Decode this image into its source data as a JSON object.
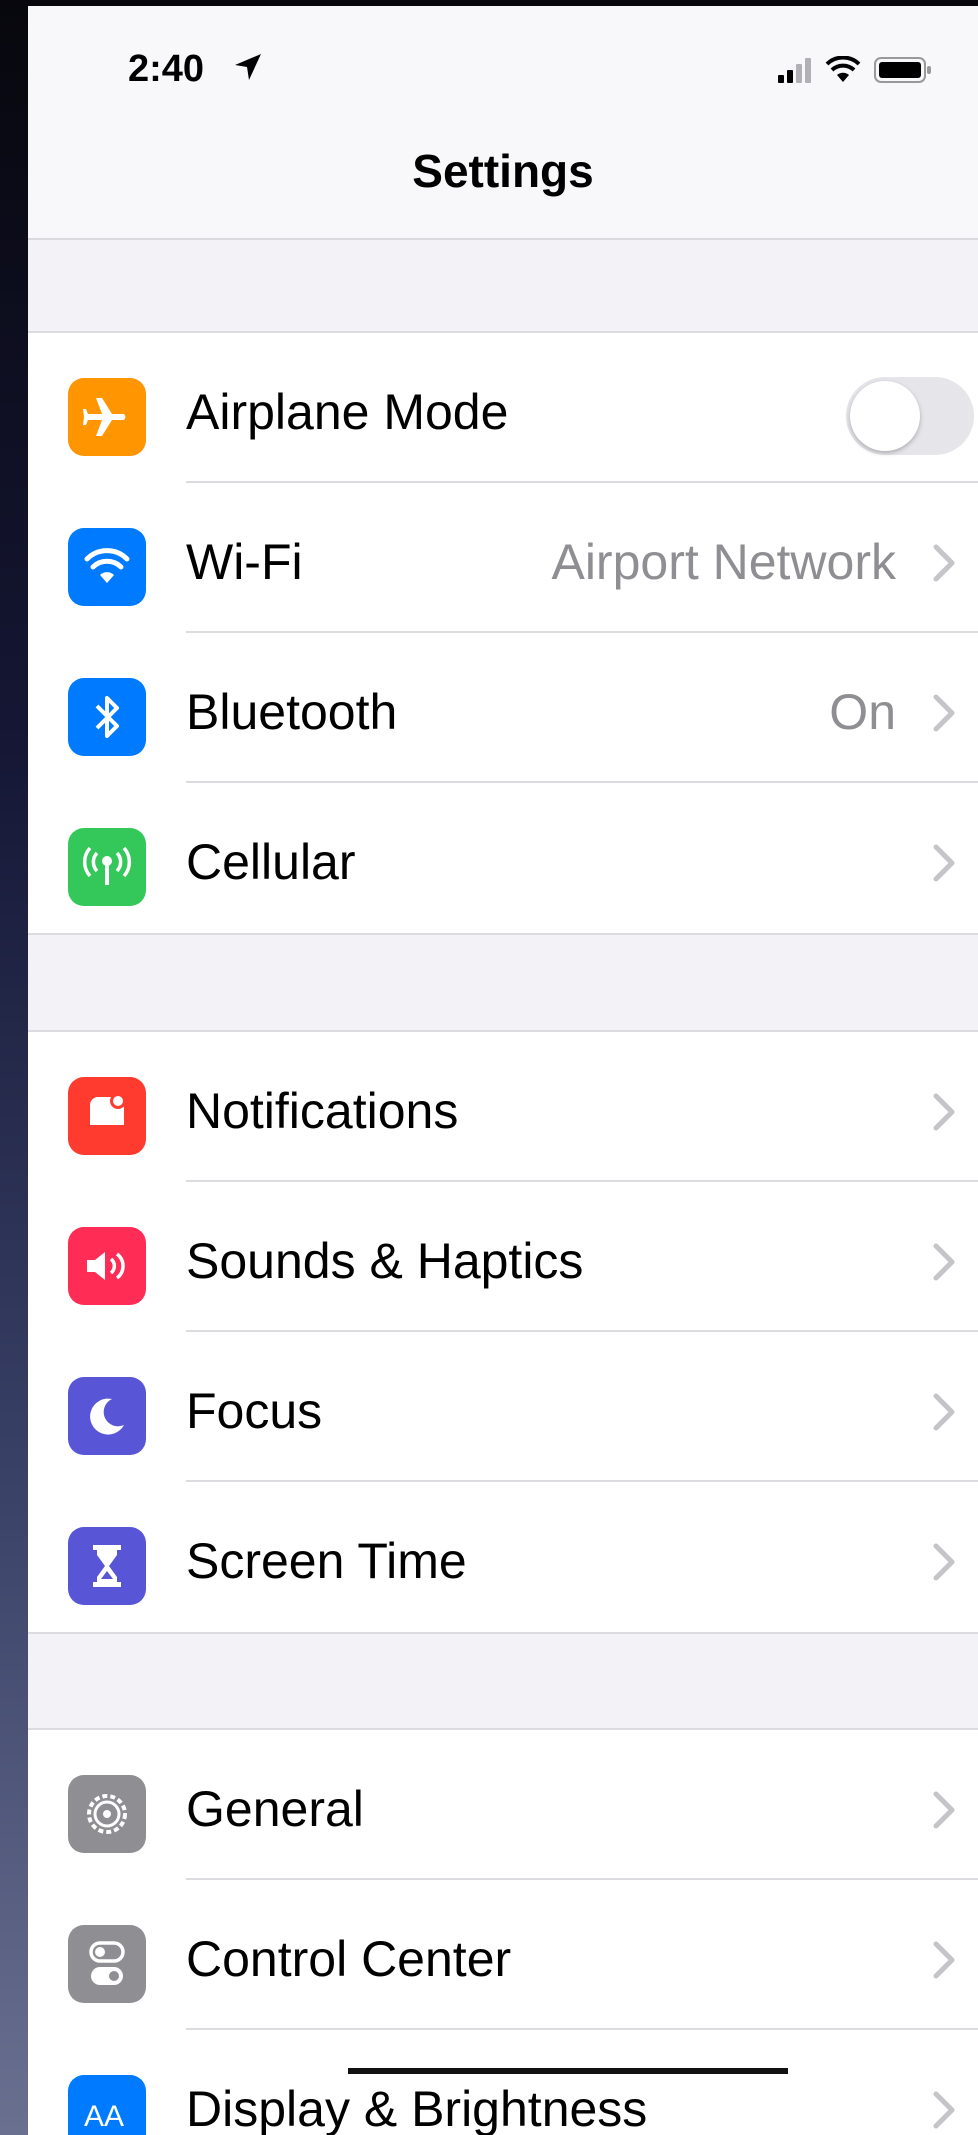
{
  "status_bar": {
    "time": "2:40"
  },
  "nav": {
    "title": "Settings"
  },
  "groups": [
    {
      "rows": [
        {
          "label": "Airplane Mode",
          "value": "",
          "icon": "airplane-icon",
          "color": "#ff9500",
          "toggle_on": false
        },
        {
          "label": "Wi-Fi",
          "value": "Airport Network",
          "icon": "wifi-icon",
          "color": "#007aff"
        },
        {
          "label": "Bluetooth",
          "value": "On",
          "icon": "bluetooth-icon",
          "color": "#007aff"
        },
        {
          "label": "Cellular",
          "value": "",
          "icon": "cellular-antenna-icon",
          "color": "#34c759"
        }
      ]
    },
    {
      "rows": [
        {
          "label": "Notifications",
          "icon": "notifications-icon",
          "color": "#ff3b30"
        },
        {
          "label": "Sounds & Haptics",
          "icon": "speaker-icon",
          "color": "#ff2d55"
        },
        {
          "label": "Focus",
          "icon": "moon-icon",
          "color": "#5856d6"
        },
        {
          "label": "Screen Time",
          "icon": "hourglass-icon",
          "color": "#5856d6"
        }
      ]
    },
    {
      "rows": [
        {
          "label": "General",
          "icon": "gear-icon",
          "color": "#8e8e93"
        },
        {
          "label": "Control Center",
          "icon": "switches-icon",
          "color": "#8e8e93"
        },
        {
          "label": "Display & Brightness",
          "icon": "text-size-icon",
          "color": "#007aff"
        }
      ]
    }
  ]
}
